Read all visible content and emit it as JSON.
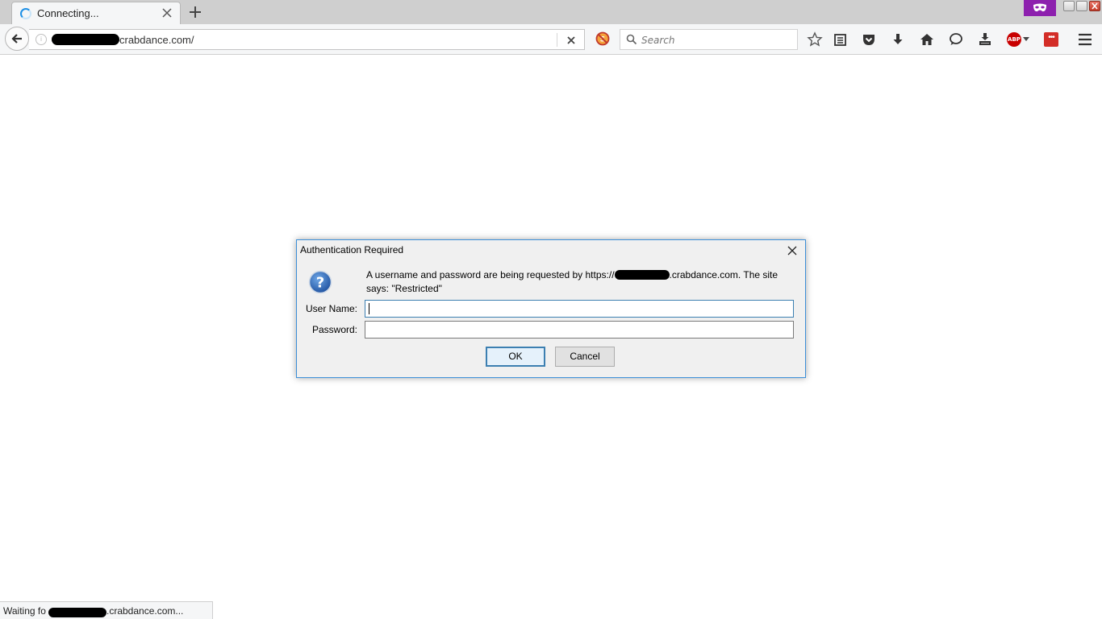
{
  "browser": {
    "tab": {
      "title": "Connecting..."
    },
    "address_bar": {
      "url_suffix": "crabdance.com/"
    },
    "search": {
      "placeholder": "Search"
    }
  },
  "dialog": {
    "title": "Authentication Required",
    "message_before": "A username and password are being requested by https://",
    "message_after": ".crabdance.com. The site says: \"Restricted\"",
    "username_label": "User Name:",
    "password_label": "Password:",
    "username_value": "",
    "password_value": "",
    "ok_label": "OK",
    "cancel_label": "Cancel"
  },
  "status": {
    "text_before": "Waiting fo",
    "text_after": ".crabdance.com..."
  },
  "icons": {
    "abp_text": "ABP",
    "lastpass_text": "•••"
  },
  "colors": {
    "private_badge": "#8d20ae",
    "abp_red": "#c80000",
    "dialog_border": "#3c8fd8",
    "focus_blue": "#3c7fb1"
  }
}
